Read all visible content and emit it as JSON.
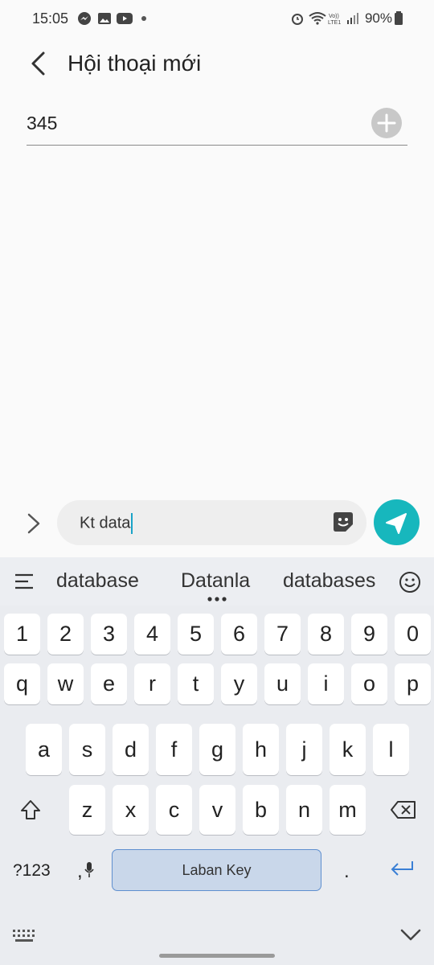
{
  "status_bar": {
    "time": "15:05",
    "battery": "90%",
    "icons": [
      "messenger-icon",
      "gallery-icon",
      "youtube-icon",
      "dot-icon",
      "alarm-icon",
      "wifi-icon",
      "volte-icon",
      "signal-icon",
      "battery-icon"
    ]
  },
  "header": {
    "title": "Hội thoại mới"
  },
  "recipient": {
    "value": "345"
  },
  "compose": {
    "text": "Kt data"
  },
  "keyboard": {
    "suggestions": [
      "database",
      "Datanla",
      "databases"
    ],
    "row_numbers": [
      "1",
      "2",
      "3",
      "4",
      "5",
      "6",
      "7",
      "8",
      "9",
      "0"
    ],
    "row1": [
      "q",
      "w",
      "e",
      "r",
      "t",
      "y",
      "u",
      "i",
      "o",
      "p"
    ],
    "row2": [
      "a",
      "s",
      "d",
      "f",
      "g",
      "h",
      "j",
      "k",
      "l"
    ],
    "row3": [
      "z",
      "x",
      "c",
      "v",
      "b",
      "n",
      "m"
    ],
    "symbols_label": "?123",
    "comma": ",",
    "period": ".",
    "space_label": "Laban Key"
  },
  "colors": {
    "accent": "#17b7bd",
    "space_key": "#c9d7ea",
    "keyboard_bg": "#eaecf0"
  }
}
